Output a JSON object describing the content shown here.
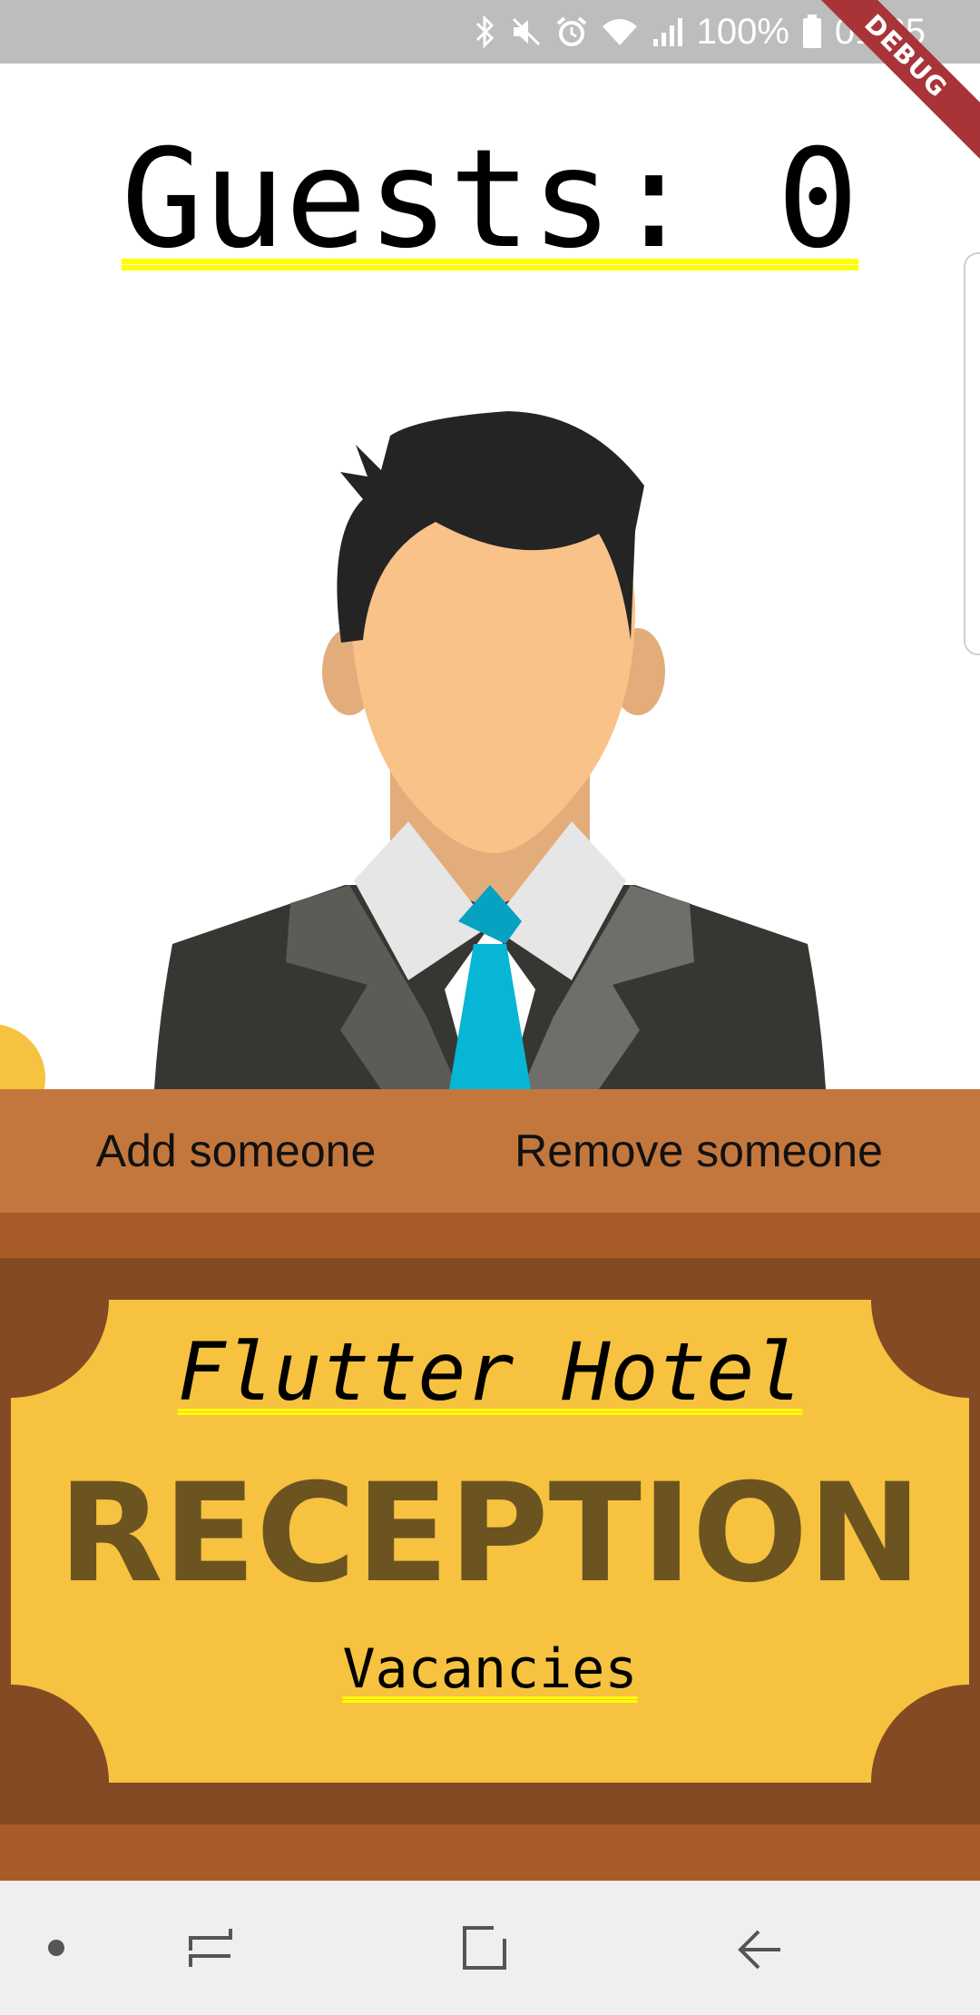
{
  "status_bar": {
    "battery_text": "100%",
    "time": "01:35",
    "icons": [
      "bluetooth-icon",
      "mute-icon",
      "alarm-icon",
      "wifi-icon",
      "signal-icon",
      "battery-icon"
    ]
  },
  "debug_banner": "DEBUG",
  "header": {
    "guests_label": "Guests: 0"
  },
  "desk": {
    "add_label": "Add someone",
    "remove_label": "Remove someone"
  },
  "plaque": {
    "hotel_name": "Flutter Hotel",
    "title": "RECEPTION",
    "status": "Vacancies"
  },
  "nav": {
    "items": [
      "dot-icon",
      "recent-apps-icon",
      "home-icon",
      "back-icon"
    ]
  },
  "colors": {
    "status_bar": "#bdbdbd",
    "desk_top": "#c4773c",
    "desk_band": "#a85d28",
    "desk_front": "#834a24",
    "plaque": "#f6c23f",
    "reception_text": "#6c5420",
    "underline": "#ffff00",
    "tie": "#06b6d4",
    "debug": "#a8343a"
  }
}
